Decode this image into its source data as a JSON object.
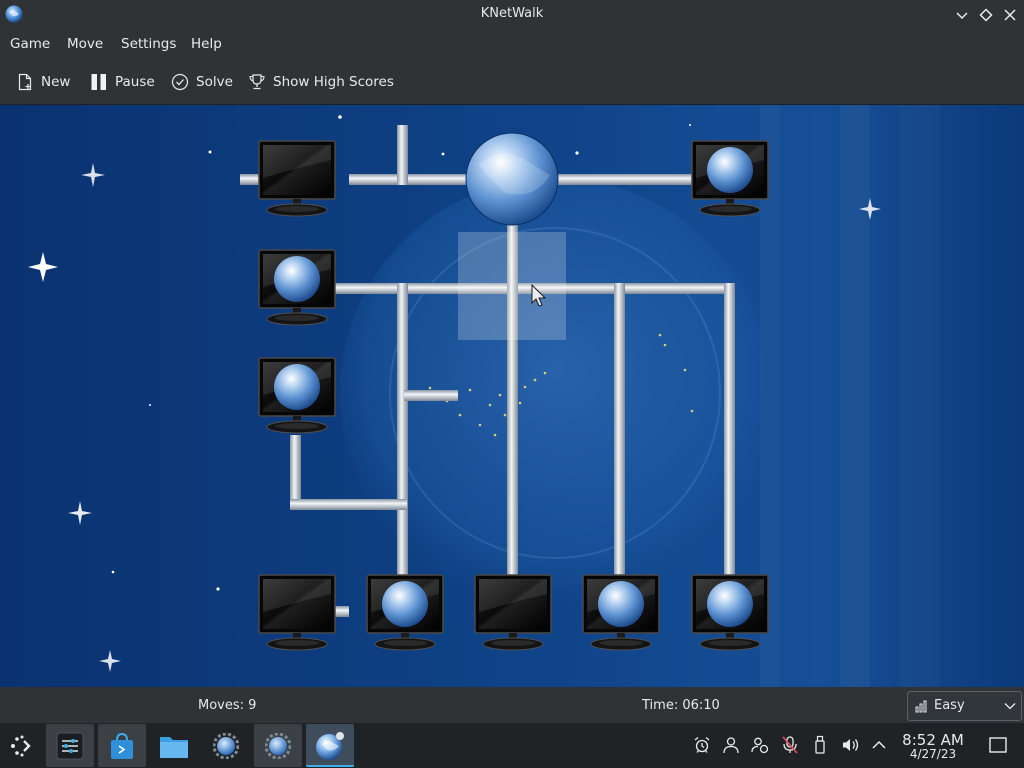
{
  "window": {
    "title": "KNetWalk"
  },
  "menu": [
    "Game",
    "Move",
    "Settings",
    "Help"
  ],
  "toolbar": {
    "new_label": "New",
    "pause_label": "Pause",
    "solve_label": "Solve",
    "scores_label": "Show High Scores"
  },
  "status": {
    "moves": "Moves: 9",
    "time": "Time: 06:10",
    "difficulty": "Easy"
  },
  "clock": {
    "time": "8:52 AM",
    "date": "4/27/23"
  },
  "colors": {
    "board": "#0e3a7a",
    "accent": "#3daee9",
    "chrome": "#2f3336",
    "taskbar": "#202326"
  },
  "icons": {
    "app": "knetwalk-globe-icon",
    "launcher": "application-launcher-icon",
    "tray": [
      "alarm-icon",
      "user-icon",
      "user-switch-icon",
      "mute-microphone-icon",
      "usb-drive-icon",
      "volume-icon",
      "chevron-up-icon"
    ]
  }
}
